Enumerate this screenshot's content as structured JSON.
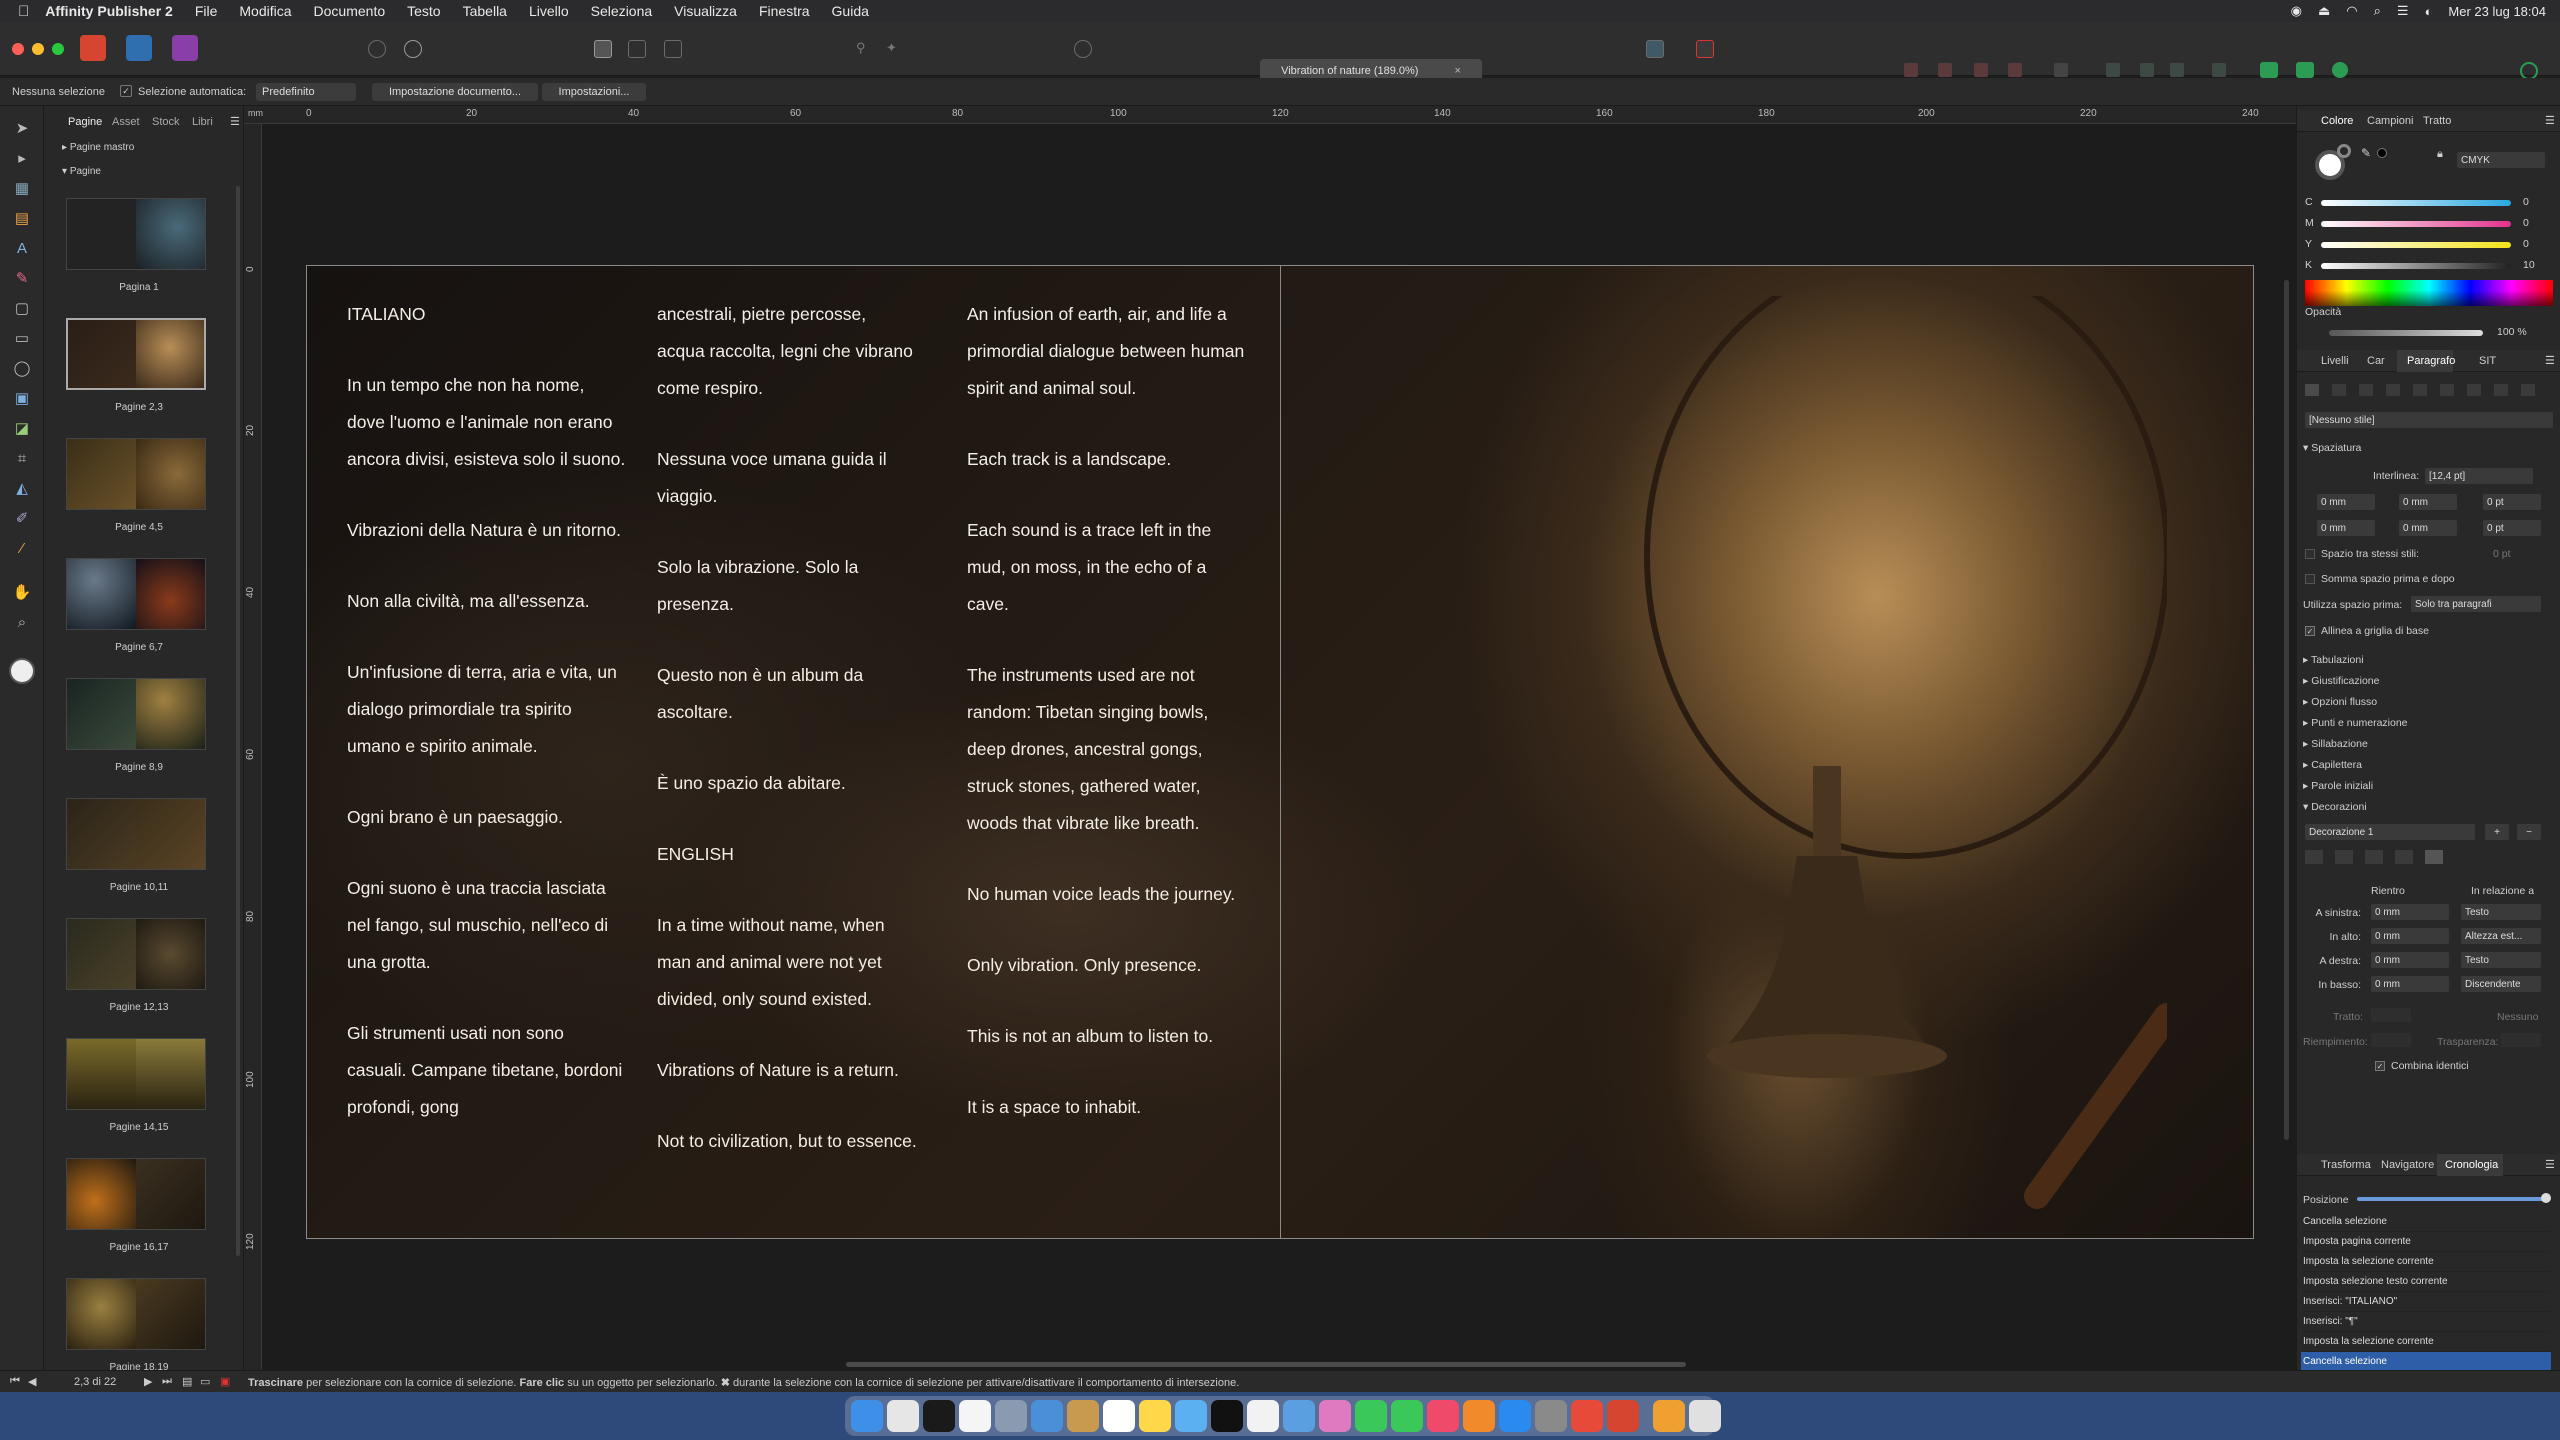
{
  "menubar": {
    "app_name": "Affinity Publisher 2",
    "items": [
      "File",
      "Modifica",
      "Documento",
      "Testo",
      "Tabella",
      "Livello",
      "Seleziona",
      "Visualizza",
      "Finestra",
      "Guida"
    ],
    "clock": "Mer 23 lug  18:04"
  },
  "toolbar": {
    "document_title": "Vibration of nature (189.0%)",
    "close_glyph": "×"
  },
  "context_bar": {
    "selection_label": "Nessuna selezione",
    "auto_select_label": "Selezione automatica:",
    "auto_select_value": "Predefinito",
    "doc_setup_button": "Impostazione documento...",
    "settings_button": "Impostazioni..."
  },
  "pages_panel": {
    "tabs": [
      "Pagine",
      "Asset",
      "Stock",
      "Libri"
    ],
    "masters_label": "Pagine mastro",
    "pages_label": "Pagine",
    "thumbs": [
      {
        "label": "Pagina 1"
      },
      {
        "label": "Pagine 2,3"
      },
      {
        "label": "Pagine 4,5"
      },
      {
        "label": "Pagine 6,7"
      },
      {
        "label": "Pagine 8,9"
      },
      {
        "label": "Pagine 10,11"
      },
      {
        "label": "Pagine 12,13"
      },
      {
        "label": "Pagine 14,15"
      },
      {
        "label": "Pagine 16,17"
      },
      {
        "label": "Pagine 18,19"
      }
    ]
  },
  "ruler": {
    "unit": "mm",
    "top_ticks": [
      "0",
      "20",
      "40",
      "60",
      "80",
      "100",
      "120",
      "140",
      "160",
      "180",
      "200",
      "220",
      "240"
    ],
    "left_ticks": [
      "0",
      "20",
      "40",
      "60",
      "80",
      "100",
      "120"
    ]
  },
  "spread": {
    "col1": [
      "ITALIANO",
      "In un tempo che non ha nome, dove l'uomo e l'animale non erano ancora divisi, esisteva solo il suono.",
      "Vibrazioni della Natura è un ritorno.",
      "Non alla civiltà, ma all'essenza.",
      "Un'infusione di terra, aria e vita, un dialogo primordiale tra spirito umano e spirito animale.",
      "Ogni brano è un paesaggio.",
      "Ogni suono è una traccia lasciata nel fango, sul muschio, nell'eco di una grotta.",
      "Gli strumenti usati non sono casuali. Campane tibetane, bordoni profondi, gong"
    ],
    "col2": [
      "ancestrali, pietre percosse, acqua raccolta, legni che vibrano come respiro.",
      "Nessuna voce umana guida il viaggio.",
      "Solo la vibrazione. Solo la presenza.",
      "Questo non è un album da ascoltare.",
      "È uno spazio da abitare.",
      "ENGLISH",
      "In a time without name, when man and animal were not yet divided, only sound existed.",
      "Vibrations of Nature is a return.",
      "Not to civilization, but to essence."
    ],
    "col3": [
      "An infusion of earth, air, and life a primordial dialogue between human spirit and animal soul.",
      "Each track is a landscape.",
      "Each sound is a trace left in the mud, on moss, in the echo of a cave.",
      "The instruments used are not random: Tibetan singing bowls, deep drones, ancestral gongs, struck stones, gathered water, woods that vibrate like breath.",
      "No human voice leads the journey.",
      "Only vibration. Only presence.",
      "This is not an album to listen to.",
      "It is a space to inhabit."
    ]
  },
  "right_panel": {
    "top_tabs": [
      "Colore",
      "Campioni",
      "Tratto"
    ],
    "color_model": "CMYK",
    "channels": [
      {
        "label": "C",
        "value": "0",
        "color": "#2aa7e0"
      },
      {
        "label": "M",
        "value": "0",
        "color": "#e0338a"
      },
      {
        "label": "Y",
        "value": "0",
        "color": "#f2e21a"
      },
      {
        "label": "K",
        "value": "10",
        "color": "#555555"
      }
    ],
    "opacity_label": "Opacità",
    "opacity_value": "100 %",
    "mid_tabs": [
      "Livelli",
      "Car",
      "Paragrafo",
      "SIT"
    ],
    "style_value": "[Nessuno stile]",
    "spacing_header": "Spaziatura",
    "leading_label": "Interlinea:",
    "leading_value": "[12,4 pt]",
    "indent_fields": [
      "0 mm",
      "0 mm",
      "0 pt",
      "0 mm",
      "0 mm",
      "0 pt"
    ],
    "same_style_label": "Spazio tra stessi stili:",
    "same_style_value": "0 pt",
    "sum_space_label": "Somma spazio prima e dopo",
    "use_space_label": "Utilizza spazio prima:",
    "use_space_value": "Solo tra paragrafi",
    "baseline_label": "Allinea a griglia di base",
    "sections": [
      "Tabulazioni",
      "Giustificazione",
      "Opzioni flusso",
      "Punti e numerazione",
      "Sillabazione",
      "Capilettera",
      "Parole iniziali",
      "Decorazioni"
    ],
    "decoration_value": "Decorazione 1",
    "deco_col_left": "Rientro",
    "deco_col_right": "In relazione a",
    "deco_rows": [
      {
        "label": "A sinistra:",
        "value": "0 mm",
        "rel": "Testo"
      },
      {
        "label": "In alto:",
        "value": "0 mm",
        "rel": "Altezza est..."
      },
      {
        "label": "A destra:",
        "value": "0 mm",
        "rel": "Testo"
      },
      {
        "label": "In basso:",
        "value": "0 mm",
        "rel": "Discendente"
      }
    ],
    "stroke_label": "Tratto:",
    "stroke_value": "Nessuno",
    "fill_label": "Riempimento:",
    "transparency_label": "Trasparenza:",
    "combine_label": "Combina identici",
    "bottom_tabs": [
      "Trasforma",
      "Navigatore",
      "Cronologia"
    ],
    "position_label": "Posizione",
    "history": [
      "Cancella selezione",
      "Imposta pagina corrente",
      "Imposta la selezione corrente",
      "Imposta selezione testo corrente",
      "Inserisci: \"ITALIANO\"",
      "Inserisci: \"¶\"",
      "Imposta la selezione corrente",
      "Cancella selezione"
    ]
  },
  "statusbar": {
    "page_indicator": "2,3 di 22",
    "hint_bold1": "Trascinare",
    "hint_text1": " per selezionare con la cornice di selezione. ",
    "hint_bold2": "Fare clic",
    "hint_text2": " su un oggetto per selezionarlo. ",
    "hint_symbol": "✖",
    "hint_text3": " durante la selezione con la cornice di selezione per attivare/disattivare il comportamento di intersezione."
  }
}
